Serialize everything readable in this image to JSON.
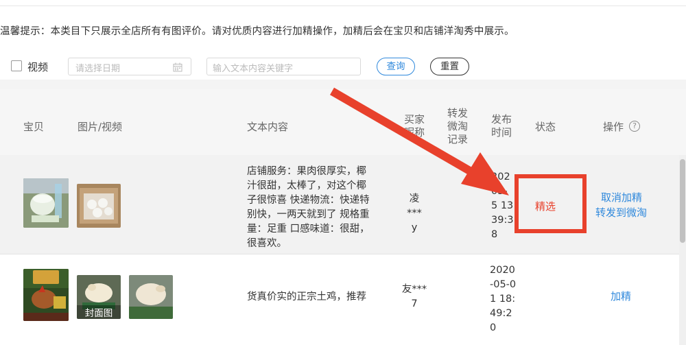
{
  "notice": "温馨提示：本类目下只展示全店所有有图评价。请对优质内容进行加精操作，加精后会在宝贝和店铺洋淘秀中展示。",
  "filters": {
    "video_label": "视频",
    "date_placeholder": "请选择日期",
    "keyword_placeholder": "输入文本内容关键字",
    "query_label": "查询",
    "reset_label": "重置"
  },
  "table": {
    "headers": {
      "item": "宝贝",
      "media": "图片/视频",
      "text": "文本内容",
      "buyer": [
        "买家",
        "昵称"
      ],
      "repost": [
        "转发",
        "微淘",
        "记录"
      ],
      "time": [
        "发布",
        "时间"
      ],
      "status": "状态",
      "ops": "操作"
    },
    "rows": [
      {
        "text_lines": [
          "店铺服务：果肉很厚实，椰",
          "汁很甜，太棒了，对这个椰",
          "子很惊喜 快递物流：快递特",
          "别快，一两天就到了 规格重",
          "量：足重 口感味道：很甜，",
          "很喜欢。"
        ],
        "buyer_lines": [
          "凌***",
          "y"
        ],
        "time_lines": [
          "202",
          "05-",
          "5 13",
          "39:3",
          "8"
        ],
        "status": "精选",
        "ops": [
          "取消加精",
          "转发到微淘"
        ]
      },
      {
        "cover_label": "封面图",
        "text": "货真价实的正宗土鸡，推荐",
        "buyer_lines": [
          "友***",
          "7"
        ],
        "time_lines": [
          "2020",
          "-05-0",
          "1 18:",
          "49:2",
          "0"
        ],
        "ops": [
          "加精"
        ]
      }
    ]
  }
}
